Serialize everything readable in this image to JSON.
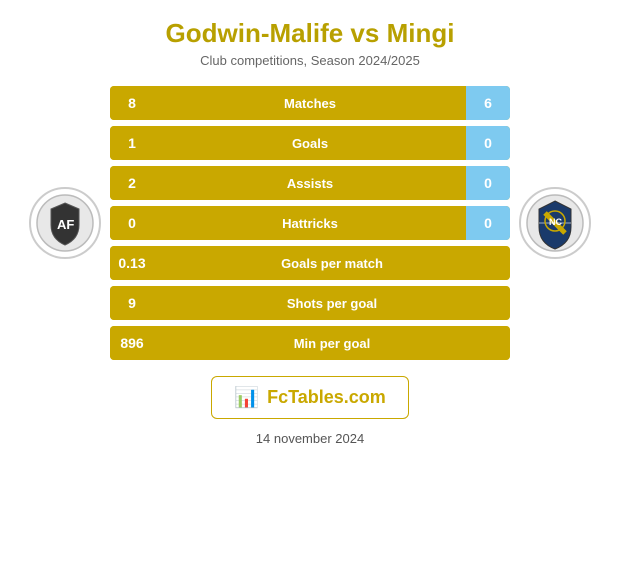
{
  "header": {
    "title": "Godwin-Malife vs Mingi",
    "subtitle": "Club competitions, Season 2024/2025"
  },
  "stats": [
    {
      "label": "Matches",
      "left": "8",
      "right": "6",
      "single": false
    },
    {
      "label": "Goals",
      "left": "1",
      "right": "0",
      "single": false
    },
    {
      "label": "Assists",
      "left": "2",
      "right": "0",
      "single": false
    },
    {
      "label": "Hattricks",
      "left": "0",
      "right": "0",
      "single": false
    },
    {
      "label": "Goals per match",
      "left": "0.13",
      "right": "",
      "single": true
    },
    {
      "label": "Shots per goal",
      "left": "9",
      "right": "",
      "single": true
    },
    {
      "label": "Min per goal",
      "left": "896",
      "right": "",
      "single": true
    }
  ],
  "watermark": {
    "text_prefix": "Fc",
    "text_highlight": "Tables",
    "text_suffix": ".com"
  },
  "footer": {
    "date": "14 november 2024"
  }
}
